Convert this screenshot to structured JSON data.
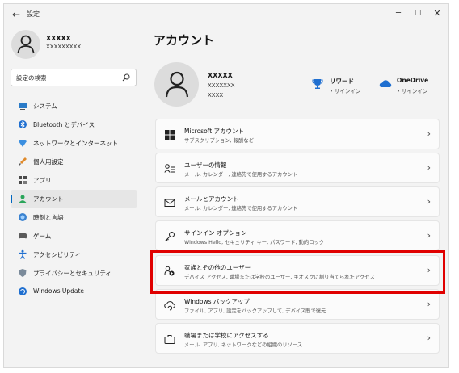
{
  "window": {
    "title": "設定",
    "back_glyph": "←",
    "minimize_glyph": "─",
    "maximize_glyph": "☐",
    "close_glyph": "✕"
  },
  "sidebar": {
    "user_name": "XXXXX",
    "user_email": "XXXXXXXXX",
    "search_placeholder": "設定の検索",
    "items": [
      {
        "label": "システム",
        "icon": "monitor-icon"
      },
      {
        "label": "Bluetooth とデバイス",
        "icon": "bluetooth-icon"
      },
      {
        "label": "ネットワークとインターネット",
        "icon": "network-icon"
      },
      {
        "label": "個人用設定",
        "icon": "brush-icon"
      },
      {
        "label": "アプリ",
        "icon": "apps-icon"
      },
      {
        "label": "アカウント",
        "icon": "person-icon",
        "active": true
      },
      {
        "label": "時刻と言語",
        "icon": "globe-icon"
      },
      {
        "label": "ゲーム",
        "icon": "gamepad-icon"
      },
      {
        "label": "アクセシビリティ",
        "icon": "accessibility-icon"
      },
      {
        "label": "プライバシーとセキュリティ",
        "icon": "shield-icon"
      },
      {
        "label": "Windows Update",
        "icon": "update-icon"
      }
    ]
  },
  "main": {
    "page_title": "アカウント",
    "account": {
      "name": "XXXXX",
      "line2": "XXXXXXX",
      "line3": "XXXX"
    },
    "services": {
      "reward_title": "リワード",
      "reward_sub": "• サインイン",
      "onedrive_title": "OneDrive",
      "onedrive_sub": "• サインイン"
    },
    "cards": [
      {
        "title": "Microsoft アカウント",
        "sub": "サブスクリプション, 報酬など",
        "icon": "windows-logo-icon"
      },
      {
        "title": "ユーザーの情報",
        "sub": "メール, カレンダー, 連絡先で使用するアカウント",
        "icon": "user-info-icon"
      },
      {
        "title": "メールとアカウント",
        "sub": "メール, カレンダー, 連絡先で使用するアカウント",
        "icon": "mail-icon"
      },
      {
        "title": "サインイン オプション",
        "sub": "Windows Hello, セキュリティ キー, パスワード, 動的ロック",
        "icon": "key-icon"
      },
      {
        "title": "家族とその他のユーザー",
        "sub": "デバイス アクセス, 職場または学校のユーザー, キオスクに割り当てられたアクセス",
        "icon": "family-icon"
      },
      {
        "title": "Windows バックアップ",
        "sub": "ファイル, アプリ, 設定をバックアップして, デバイス間で復元",
        "icon": "backup-icon"
      },
      {
        "title": "職場または学校にアクセスする",
        "sub": "メール, アプリ, ネットワークなどの組織のリソース",
        "icon": "briefcase-icon"
      }
    ],
    "chevron": "›"
  },
  "colors": {
    "accent": "#0067c0",
    "highlight_border": "#e00000"
  }
}
